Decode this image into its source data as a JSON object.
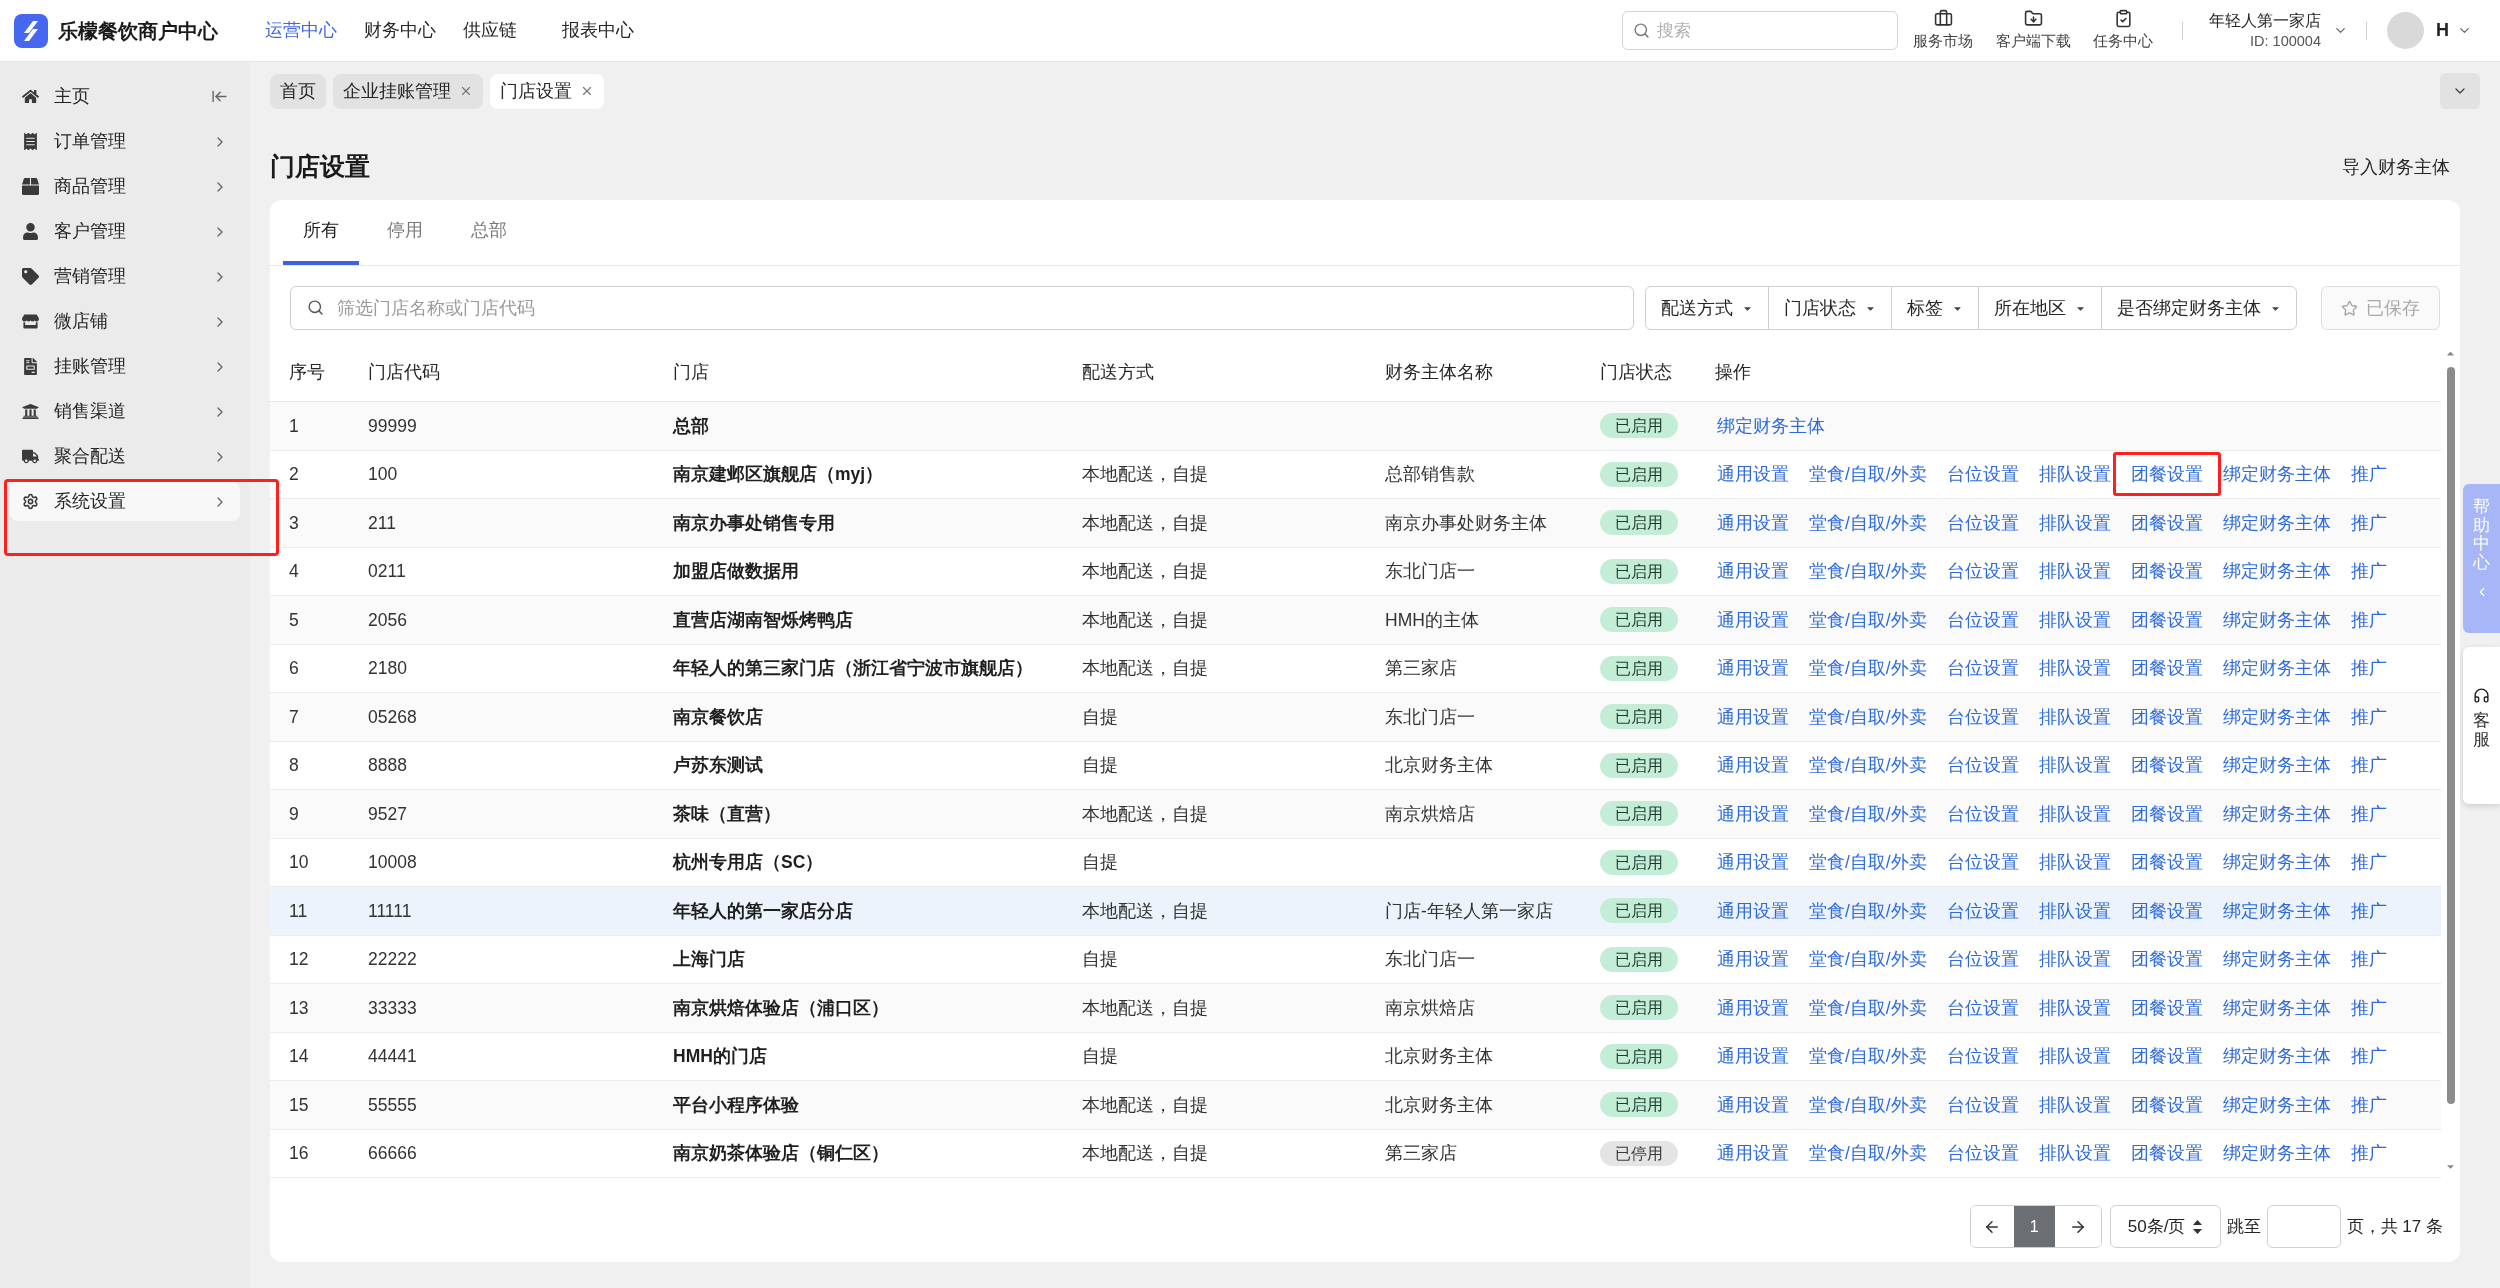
{
  "header": {
    "logo_text": "乐檬餐饮商户中心",
    "nav": [
      {
        "label": "运营中心",
        "selected": true
      },
      {
        "label": "财务中心",
        "selected": false
      },
      {
        "label": "供应链",
        "selected": false
      },
      {
        "label": "报表中心",
        "selected": false
      }
    ],
    "search": {
      "placeholder": "搜索"
    },
    "tools": [
      {
        "kind": "market",
        "label": "服务市场"
      },
      {
        "kind": "download",
        "label": "客户端下载"
      },
      {
        "kind": "tasks",
        "label": "任务中心"
      }
    ],
    "store": {
      "name": "年轻人第一家店",
      "id": "ID: 100004"
    },
    "user": {
      "initial": "H"
    }
  },
  "sidebar": {
    "items": [
      {
        "kind": "home",
        "label": "主页",
        "selected": false,
        "highlighted": false
      },
      {
        "kind": "orders",
        "label": "订单管理",
        "selected": false,
        "highlighted": false
      },
      {
        "kind": "products",
        "label": "商品管理",
        "selected": false,
        "highlighted": false
      },
      {
        "kind": "customers",
        "label": "客户管理",
        "selected": false,
        "highlighted": false
      },
      {
        "kind": "marketing",
        "label": "营销管理",
        "selected": false,
        "highlighted": false
      },
      {
        "kind": "shop",
        "label": "微店铺",
        "selected": false,
        "highlighted": false
      },
      {
        "kind": "credit",
        "label": "挂账管理",
        "selected": false,
        "highlighted": false
      },
      {
        "kind": "channels",
        "label": "销售渠道",
        "selected": false,
        "highlighted": false
      },
      {
        "kind": "delivery",
        "label": "聚合配送",
        "selected": false,
        "highlighted": false
      },
      {
        "kind": "settings",
        "label": "系统设置",
        "selected": true,
        "highlighted": true
      }
    ]
  },
  "open_tabs": [
    {
      "label": "首页",
      "closable": false,
      "selected": false
    },
    {
      "label": "企业挂账管理",
      "closable": true,
      "selected": false
    },
    {
      "label": "门店设置",
      "closable": true,
      "selected": true
    }
  ],
  "page": {
    "title": "门店设置",
    "action": "导入财务主体"
  },
  "card": {
    "tabs": [
      {
        "label": "所有",
        "selected": true
      },
      {
        "label": "停用",
        "selected": false
      },
      {
        "label": "总部",
        "selected": false
      }
    ],
    "search": {
      "placeholder": "筛选门店名称或门店代码"
    },
    "filters": [
      {
        "label": "配送方式"
      },
      {
        "label": "门店状态"
      },
      {
        "label": "标签"
      },
      {
        "label": "所在地区"
      },
      {
        "label": "是否绑定财务主体"
      }
    ],
    "saved_button": {
      "label": "已保存",
      "disabled": true
    }
  },
  "table": {
    "columns": [
      "序号",
      "门店代码",
      "门店",
      "配送方式",
      "财务主体名称",
      "门店状态",
      "操作"
    ],
    "rows": [
      {
        "index": "1",
        "code": "99999",
        "store": "总部",
        "status": {
          "label": "已启用",
          "enabled": true
        },
        "selected": false,
        "actions": [
          {
            "label": "绑定财务主体",
            "highlighted": false
          }
        ]
      },
      {
        "index": "2",
        "code": "100",
        "store": "南京建邺区旗舰店（myj）",
        "delivery": "本地配送，自提",
        "finance_entity": "总部销售款",
        "status": {
          "label": "已启用",
          "enabled": true
        },
        "selected": false,
        "actions": [
          {
            "label": "通用设置",
            "highlighted": false
          },
          {
            "label": "堂食/自取/外卖",
            "highlighted": false
          },
          {
            "label": "台位设置",
            "highlighted": false
          },
          {
            "label": "排队设置",
            "highlighted": false
          },
          {
            "label": "团餐设置",
            "highlighted": true
          },
          {
            "label": "绑定财务主体",
            "highlighted": false
          },
          {
            "label": "推广",
            "highlighted": false
          }
        ]
      },
      {
        "index": "3",
        "code": "211",
        "store": "南京办事处销售专用",
        "delivery": "本地配送，自提",
        "finance_entity": "南京办事处财务主体",
        "status": {
          "label": "已启用",
          "enabled": true
        },
        "selected": false,
        "actions": [
          {
            "label": "通用设置",
            "highlighted": false
          },
          {
            "label": "堂食/自取/外卖",
            "highlighted": false
          },
          {
            "label": "台位设置",
            "highlighted": false
          },
          {
            "label": "排队设置",
            "highlighted": false
          },
          {
            "label": "团餐设置",
            "highlighted": false
          },
          {
            "label": "绑定财务主体",
            "highlighted": false
          },
          {
            "label": "推广",
            "highlighted": false
          }
        ]
      },
      {
        "index": "4",
        "code": "0211",
        "store": "加盟店做数据用",
        "delivery": "本地配送，自提",
        "finance_entity": "东北门店一",
        "status": {
          "label": "已启用",
          "enabled": true
        },
        "selected": false,
        "actions": [
          {
            "label": "通用设置",
            "highlighted": false
          },
          {
            "label": "堂食/自取/外卖",
            "highlighted": false
          },
          {
            "label": "台位设置",
            "highlighted": false
          },
          {
            "label": "排队设置",
            "highlighted": false
          },
          {
            "label": "团餐设置",
            "highlighted": false
          },
          {
            "label": "绑定财务主体",
            "highlighted": false
          },
          {
            "label": "推广",
            "highlighted": false
          }
        ]
      },
      {
        "index": "5",
        "code": "2056",
        "store": "直营店湖南智烁烤鸭店",
        "delivery": "本地配送，自提",
        "finance_entity": "HMH的主体",
        "status": {
          "label": "已启用",
          "enabled": true
        },
        "selected": false,
        "actions": [
          {
            "label": "通用设置",
            "highlighted": false
          },
          {
            "label": "堂食/自取/外卖",
            "highlighted": false
          },
          {
            "label": "台位设置",
            "highlighted": false
          },
          {
            "label": "排队设置",
            "highlighted": false
          },
          {
            "label": "团餐设置",
            "highlighted": false
          },
          {
            "label": "绑定财务主体",
            "highlighted": false
          },
          {
            "label": "推广",
            "highlighted": false
          }
        ]
      },
      {
        "index": "6",
        "code": "2180",
        "store": "年轻人的第三家门店（浙江省宁波市旗舰店）",
        "delivery": "本地配送，自提",
        "finance_entity": "第三家店",
        "status": {
          "label": "已启用",
          "enabled": true
        },
        "selected": false,
        "actions": [
          {
            "label": "通用设置",
            "highlighted": false
          },
          {
            "label": "堂食/自取/外卖",
            "highlighted": false
          },
          {
            "label": "台位设置",
            "highlighted": false
          },
          {
            "label": "排队设置",
            "highlighted": false
          },
          {
            "label": "团餐设置",
            "highlighted": false
          },
          {
            "label": "绑定财务主体",
            "highlighted": false
          },
          {
            "label": "推广",
            "highlighted": false
          }
        ]
      },
      {
        "index": "7",
        "code": "05268",
        "store": "南京餐饮店",
        "delivery": "自提",
        "finance_entity": "东北门店一",
        "status": {
          "label": "已启用",
          "enabled": true
        },
        "selected": false,
        "actions": [
          {
            "label": "通用设置",
            "highlighted": false
          },
          {
            "label": "堂食/自取/外卖",
            "highlighted": false
          },
          {
            "label": "台位设置",
            "highlighted": false
          },
          {
            "label": "排队设置",
            "highlighted": false
          },
          {
            "label": "团餐设置",
            "highlighted": false
          },
          {
            "label": "绑定财务主体",
            "highlighted": false
          },
          {
            "label": "推广",
            "highlighted": false
          }
        ]
      },
      {
        "index": "8",
        "code": "8888",
        "store": "卢苏东测试",
        "delivery": "自提",
        "finance_entity": "北京财务主体",
        "status": {
          "label": "已启用",
          "enabled": true
        },
        "selected": false,
        "actions": [
          {
            "label": "通用设置",
            "highlighted": false
          },
          {
            "label": "堂食/自取/外卖",
            "highlighted": false
          },
          {
            "label": "台位设置",
            "highlighted": false
          },
          {
            "label": "排队设置",
            "highlighted": false
          },
          {
            "label": "团餐设置",
            "highlighted": false
          },
          {
            "label": "绑定财务主体",
            "highlighted": false
          },
          {
            "label": "推广",
            "highlighted": false
          }
        ]
      },
      {
        "index": "9",
        "code": "9527",
        "store": "茶味（直营）",
        "delivery": "本地配送，自提",
        "finance_entity": "南京烘焙店",
        "status": {
          "label": "已启用",
          "enabled": true
        },
        "selected": false,
        "actions": [
          {
            "label": "通用设置",
            "highlighted": false
          },
          {
            "label": "堂食/自取/外卖",
            "highlighted": false
          },
          {
            "label": "台位设置",
            "highlighted": false
          },
          {
            "label": "排队设置",
            "highlighted": false
          },
          {
            "label": "团餐设置",
            "highlighted": false
          },
          {
            "label": "绑定财务主体",
            "highlighted": false
          },
          {
            "label": "推广",
            "highlighted": false
          }
        ]
      },
      {
        "index": "10",
        "code": "10008",
        "store": "杭州专用店（SC）",
        "delivery": "自提",
        "status": {
          "label": "已启用",
          "enabled": true
        },
        "selected": false,
        "actions": [
          {
            "label": "通用设置",
            "highlighted": false
          },
          {
            "label": "堂食/自取/外卖",
            "highlighted": false
          },
          {
            "label": "台位设置",
            "highlighted": false
          },
          {
            "label": "排队设置",
            "highlighted": false
          },
          {
            "label": "团餐设置",
            "highlighted": false
          },
          {
            "label": "绑定财务主体",
            "highlighted": false
          },
          {
            "label": "推广",
            "highlighted": false
          }
        ]
      },
      {
        "index": "11",
        "code": "11111",
        "store": "年轻人的第一家店分店",
        "delivery": "本地配送，自提",
        "finance_entity": "门店-年轻人第一家店",
        "status": {
          "label": "已启用",
          "enabled": true
        },
        "selected": true,
        "actions": [
          {
            "label": "通用设置",
            "highlighted": false
          },
          {
            "label": "堂食/自取/外卖",
            "highlighted": false
          },
          {
            "label": "台位设置",
            "highlighted": false
          },
          {
            "label": "排队设置",
            "highlighted": false
          },
          {
            "label": "团餐设置",
            "highlighted": false
          },
          {
            "label": "绑定财务主体",
            "highlighted": false
          },
          {
            "label": "推广",
            "highlighted": false
          }
        ]
      },
      {
        "index": "12",
        "code": "22222",
        "store": "上海门店",
        "delivery": "自提",
        "finance_entity": "东北门店一",
        "status": {
          "label": "已启用",
          "enabled": true
        },
        "selected": false,
        "actions": [
          {
            "label": "通用设置",
            "highlighted": false
          },
          {
            "label": "堂食/自取/外卖",
            "highlighted": false
          },
          {
            "label": "台位设置",
            "highlighted": false
          },
          {
            "label": "排队设置",
            "highlighted": false
          },
          {
            "label": "团餐设置",
            "highlighted": false
          },
          {
            "label": "绑定财务主体",
            "highlighted": false
          },
          {
            "label": "推广",
            "highlighted": false
          }
        ]
      },
      {
        "index": "13",
        "code": "33333",
        "store": "南京烘焙体验店（浦口区）",
        "delivery": "本地配送，自提",
        "finance_entity": "南京烘焙店",
        "status": {
          "label": "已启用",
          "enabled": true
        },
        "selected": false,
        "actions": [
          {
            "label": "通用设置",
            "highlighted": false
          },
          {
            "label": "堂食/自取/外卖",
            "highlighted": false
          },
          {
            "label": "台位设置",
            "highlighted": false
          },
          {
            "label": "排队设置",
            "highlighted": false
          },
          {
            "label": "团餐设置",
            "highlighted": false
          },
          {
            "label": "绑定财务主体",
            "highlighted": false
          },
          {
            "label": "推广",
            "highlighted": false
          }
        ]
      },
      {
        "index": "14",
        "code": "44441",
        "store": "HMH的门店",
        "delivery": "自提",
        "finance_entity": "北京财务主体",
        "status": {
          "label": "已启用",
          "enabled": true
        },
        "selected": false,
        "actions": [
          {
            "label": "通用设置",
            "highlighted": false
          },
          {
            "label": "堂食/自取/外卖",
            "highlighted": false
          },
          {
            "label": "台位设置",
            "highlighted": false
          },
          {
            "label": "排队设置",
            "highlighted": false
          },
          {
            "label": "团餐设置",
            "highlighted": false
          },
          {
            "label": "绑定财务主体",
            "highlighted": false
          },
          {
            "label": "推广",
            "highlighted": false
          }
        ]
      },
      {
        "index": "15",
        "code": "55555",
        "store": "平台小程序体验",
        "delivery": "本地配送，自提",
        "finance_entity": "北京财务主体",
        "status": {
          "label": "已启用",
          "enabled": true
        },
        "selected": false,
        "actions": [
          {
            "label": "通用设置",
            "highlighted": false
          },
          {
            "label": "堂食/自取/外卖",
            "highlighted": false
          },
          {
            "label": "台位设置",
            "highlighted": false
          },
          {
            "label": "排队设置",
            "highlighted": false
          },
          {
            "label": "团餐设置",
            "highlighted": false
          },
          {
            "label": "绑定财务主体",
            "highlighted": false
          },
          {
            "label": "推广",
            "highlighted": false
          }
        ]
      },
      {
        "index": "16",
        "code": "66666",
        "store": "南京奶茶体验店（铜仁区）",
        "delivery": "本地配送，自提",
        "finance_entity": "第三家店",
        "status": {
          "label": "已停用",
          "enabled": false
        },
        "selected": false,
        "actions": [
          {
            "label": "通用设置",
            "highlighted": false
          },
          {
            "label": "堂食/自取/外卖",
            "highlighted": false
          },
          {
            "label": "台位设置",
            "highlighted": false
          },
          {
            "label": "排队设置",
            "highlighted": false
          },
          {
            "label": "团餐设置",
            "highlighted": false
          },
          {
            "label": "绑定财务主体",
            "highlighted": false
          },
          {
            "label": "推广",
            "highlighted": false
          }
        ]
      }
    ]
  },
  "pagination": {
    "current_page": "1",
    "page_size": "50条/页",
    "jump_label": "跳至",
    "total": "页，共 17 条"
  },
  "side_panel": {
    "help": "帮助中心",
    "service": "客服"
  }
}
